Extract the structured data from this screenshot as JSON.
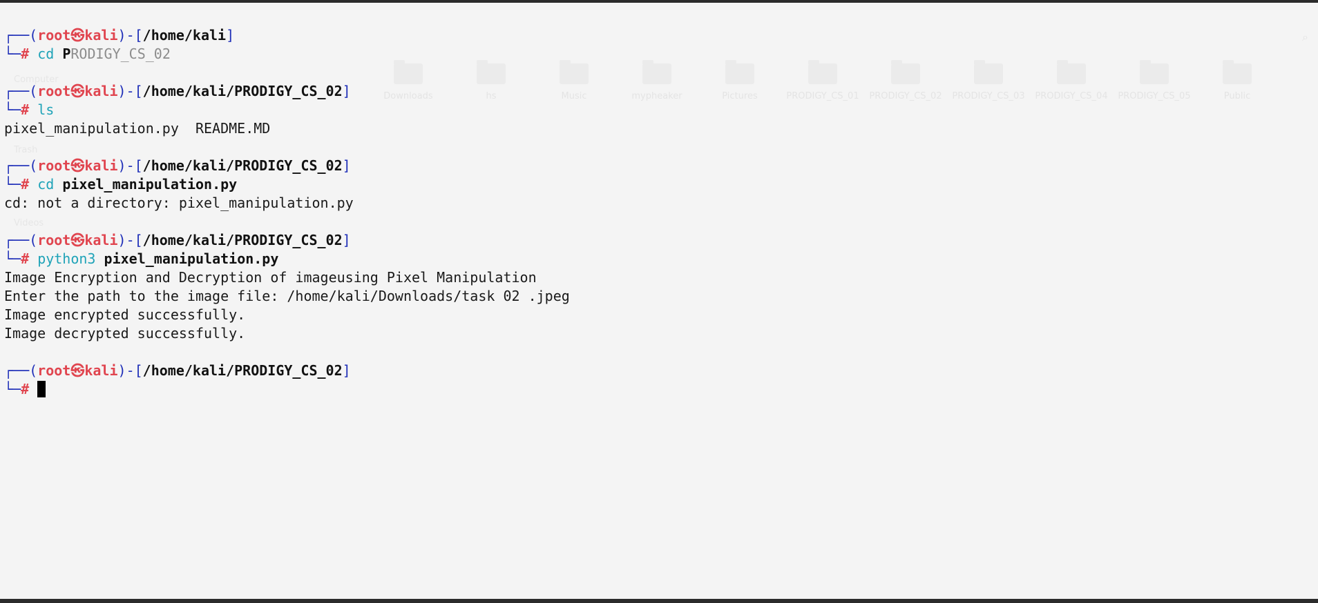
{
  "prompt": {
    "box_top": "┌──",
    "box_bottom": "└─",
    "open_paren": "(",
    "user": "root",
    "at_symbol": "㉿",
    "host": "kali",
    "close_paren": ")",
    "sep": "-",
    "open_bracket": "[",
    "close_bracket": "]",
    "hash": "#"
  },
  "blocks": [
    {
      "cwd": "/home/kali",
      "command": "cd",
      "arg_bold": "P",
      "arg_dim": "RODIGY_CS_02",
      "output": []
    },
    {
      "cwd": "/home/kali/PRODIGY_CS_02",
      "command": "ls",
      "arg_bold": "",
      "arg_dim": "",
      "output": [
        "pixel_manipulation.py  README.MD"
      ]
    },
    {
      "cwd": "/home/kali/PRODIGY_CS_02",
      "command": "cd",
      "arg_bold": "pixel_manipulation.py",
      "arg_dim": "",
      "output": [
        "cd: not a directory: pixel_manipulation.py"
      ]
    },
    {
      "cwd": "/home/kali/PRODIGY_CS_02",
      "command": "python3",
      "arg_bold": "pixel_manipulation.py",
      "arg_dim": "",
      "output": [
        "Image Encryption and Decryption of imageusing Pixel Manipulation",
        "Enter the path to the image file: /home/kali/Downloads/task 02 .jpeg",
        "Image encrypted successfully.",
        "Image decrypted successfully."
      ]
    },
    {
      "cwd": "/home/kali/PRODIGY_CS_02",
      "command": "",
      "arg_bold": "",
      "arg_dim": "",
      "output": []
    }
  ],
  "ghost": {
    "folders": [
      "Downloads",
      "hs",
      "Music",
      "mypheaker",
      "Pictures",
      "PRODIGY_CS_01",
      "PRODIGY_CS_02",
      "PRODIGY_CS_03",
      "PRODIGY_CS_04",
      "PRODIGY_CS_05",
      "Public"
    ],
    "sidebar": [
      "Computer",
      "Trash",
      "Videos"
    ]
  },
  "colors": {
    "background": "#f4f4f4",
    "box": "#1f2fb8",
    "user_host": "#e0454f",
    "command": "#1fa3b8",
    "text": "#1a1a1a"
  }
}
